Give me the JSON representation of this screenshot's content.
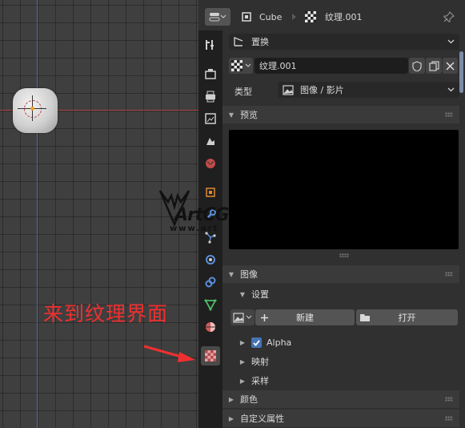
{
  "header": {
    "object_name": "Cube",
    "texture_name": "纹理.001"
  },
  "texture_context": {
    "value": "置换"
  },
  "texture_selector": {
    "name": "纹理.001"
  },
  "type_row": {
    "label": "类型",
    "value": "图像 / 影片"
  },
  "sections": {
    "preview": "预览",
    "image": "图像",
    "settings": "设置",
    "alpha": "Alpha",
    "mapping": "映射",
    "sampling": "采样",
    "colors": "颜色",
    "custom_properties": "自定义属性"
  },
  "image_buttons": {
    "new": "新建",
    "open": "打开"
  },
  "annotation": "来到纹理界面",
  "watermark": {
    "brand": "ArtCG",
    "url": "www.art"
  },
  "colors": {
    "annotation_red": "#f03030",
    "accent_blue": "#4772b3",
    "axis_red": "#b04545",
    "axis_blue": "#4a6cc2"
  }
}
